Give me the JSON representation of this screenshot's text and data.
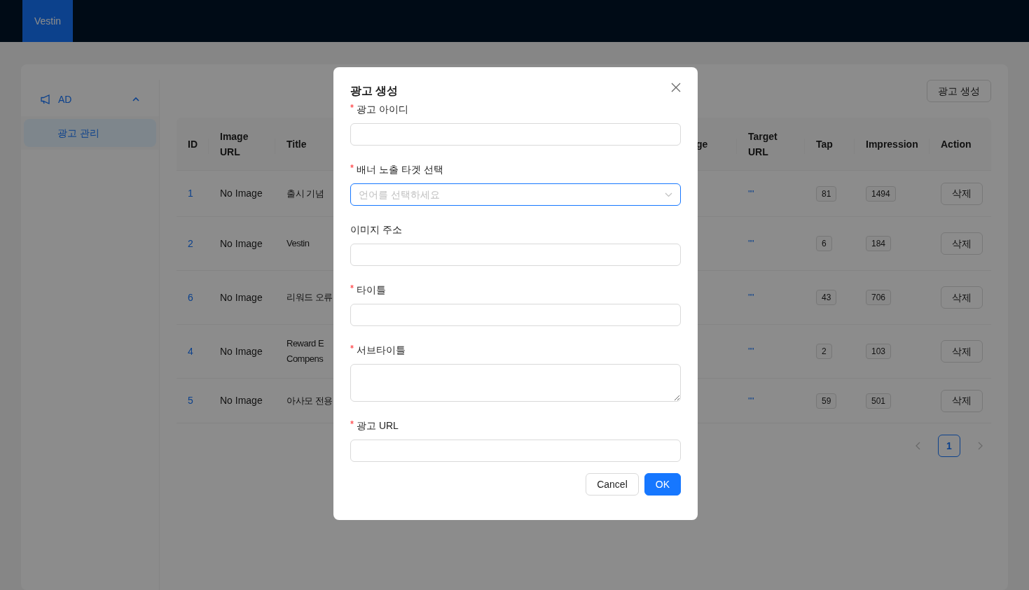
{
  "header": {
    "logo": "Vestin"
  },
  "sidebar": {
    "menu": [
      {
        "label": "AD",
        "expanded": true,
        "children": [
          {
            "label": "광고 관리",
            "selected": true
          }
        ]
      }
    ]
  },
  "toolbar": {
    "create_button": "광고 생성"
  },
  "table": {
    "columns": [
      "ID",
      "Image URL",
      "Title",
      "ge",
      "Target URL",
      "Tap",
      "Impression",
      "Action"
    ],
    "rows": [
      {
        "id": "1",
        "image_url": "No Image",
        "title": "출시 기념",
        "target_url": "\"\"",
        "tap": "81",
        "impression": "1494",
        "action": "삭제"
      },
      {
        "id": "2",
        "image_url": "No Image",
        "title": "Vestin",
        "target_url": "\"\"",
        "tap": "6",
        "impression": "184",
        "action": "삭제"
      },
      {
        "id": "6",
        "image_url": "No Image",
        "title": "리워드 오류",
        "target_url": "\"\"",
        "tap": "43",
        "impression": "706",
        "action": "삭제"
      },
      {
        "id": "4",
        "image_url": "No Image",
        "title": "Reward E\nCompens",
        "target_url": "\"\"",
        "tap": "2",
        "impression": "103",
        "action": "삭제"
      },
      {
        "id": "5",
        "image_url": "No Image",
        "title": "아사모 전용",
        "target_url": "\"\"",
        "tap": "59",
        "impression": "501",
        "action": "삭제"
      }
    ]
  },
  "pagination": {
    "pages": [
      {
        "label": "1",
        "selected": true
      }
    ]
  },
  "modal": {
    "title": "광고 생성",
    "fields": [
      {
        "label": "광고 아이디",
        "required": true,
        "kind": "input",
        "focused": false
      },
      {
        "label": "배너 노출 타겟 선택",
        "required": true,
        "kind": "select",
        "placeholder": "언어를 선택하세요",
        "focused": true
      },
      {
        "label": "이미지 주소",
        "required": false,
        "kind": "input",
        "focused": false
      },
      {
        "label": "타이틀",
        "required": true,
        "kind": "input",
        "focused": false
      },
      {
        "label": "서브타이틀",
        "required": true,
        "kind": "textarea",
        "focused": false
      },
      {
        "label": "광고 URL",
        "required": true,
        "kind": "input",
        "focused": false
      }
    ],
    "buttons": [
      {
        "label": "Cancel",
        "kind": "default"
      },
      {
        "label": "OK",
        "kind": "primary"
      }
    ]
  }
}
